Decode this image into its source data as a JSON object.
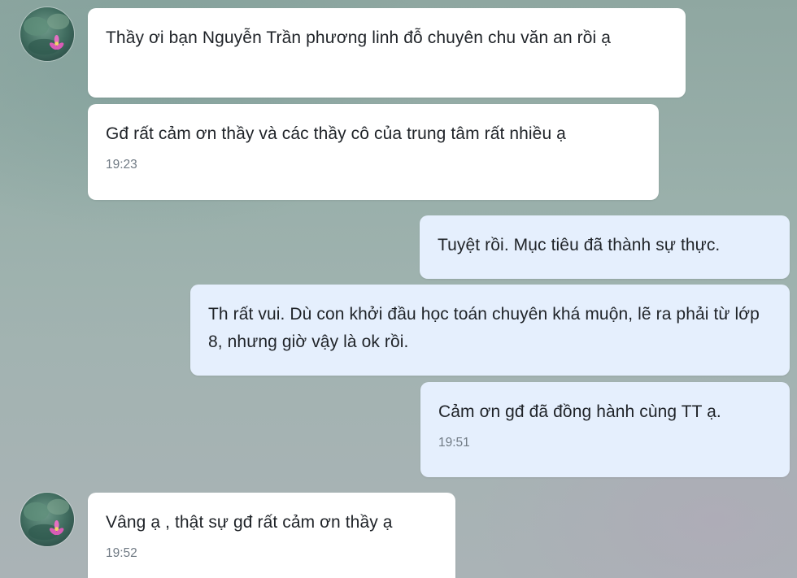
{
  "conversation": {
    "contact_avatar": "lotus-flower-avatar",
    "messages": [
      {
        "sender": "contact",
        "text": "Thầy ơi bạn Nguyễn Trần phương linh đỗ chuyên chu văn an rồi ạ",
        "time": ""
      },
      {
        "sender": "contact",
        "text": "Gđ rất cảm ơn thầy và các thầy cô của trung tâm rất nhiều ạ",
        "time": "19:23"
      },
      {
        "sender": "me",
        "text": "Tuyệt rồi. Mục tiêu đã thành sự thực.",
        "time": ""
      },
      {
        "sender": "me",
        "text": "Th rất vui. Dù con khởi đầu học toán chuyên khá muộn, lẽ ra phải từ lớp 8, nhưng giờ vậy là ok rồi.",
        "time": ""
      },
      {
        "sender": "me",
        "text": "Cảm ơn gđ đã đồng hành cùng TT ạ.",
        "time": "19:51"
      },
      {
        "sender": "contact",
        "text": "Vâng ạ , thật sự gđ rất cảm ơn thầy ạ",
        "time": "19:52"
      }
    ]
  },
  "colors": {
    "incoming_bubble": "#ffffff",
    "outgoing_bubble": "#e5effd",
    "text": "#1f2328",
    "timestamp": "#707a84"
  }
}
